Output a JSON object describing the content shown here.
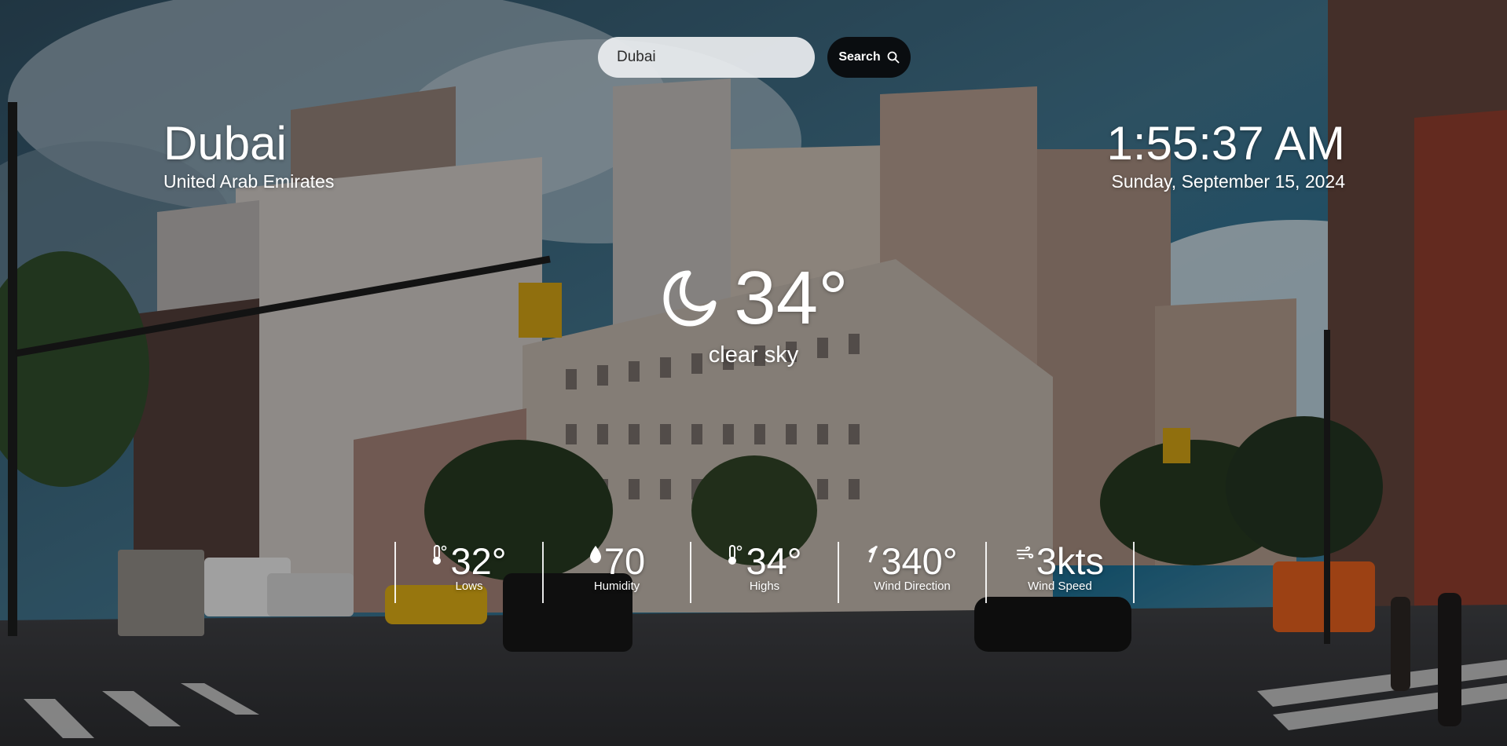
{
  "search": {
    "value": "Dubai",
    "button_label": "Search",
    "icon": "search-icon"
  },
  "location": {
    "city": "Dubai",
    "country": "United Arab Emirates"
  },
  "clock": {
    "time": "1:55:37 AM",
    "date": "Sunday, September 15, 2024"
  },
  "current": {
    "icon": "moon-icon",
    "temperature": "34°",
    "condition": "clear sky"
  },
  "stats": [
    {
      "icon": "thermometer-icon",
      "value": "32°",
      "label": "Lows"
    },
    {
      "icon": "droplet-icon",
      "value": "70",
      "label": "Humidity"
    },
    {
      "icon": "thermometer-icon",
      "value": "34°",
      "label": "Highs"
    },
    {
      "icon": "wind-direction-icon",
      "value": "340°",
      "label": "Wind Direction"
    },
    {
      "icon": "wind-icon",
      "value": "3kts",
      "label": "Wind Speed"
    }
  ]
}
